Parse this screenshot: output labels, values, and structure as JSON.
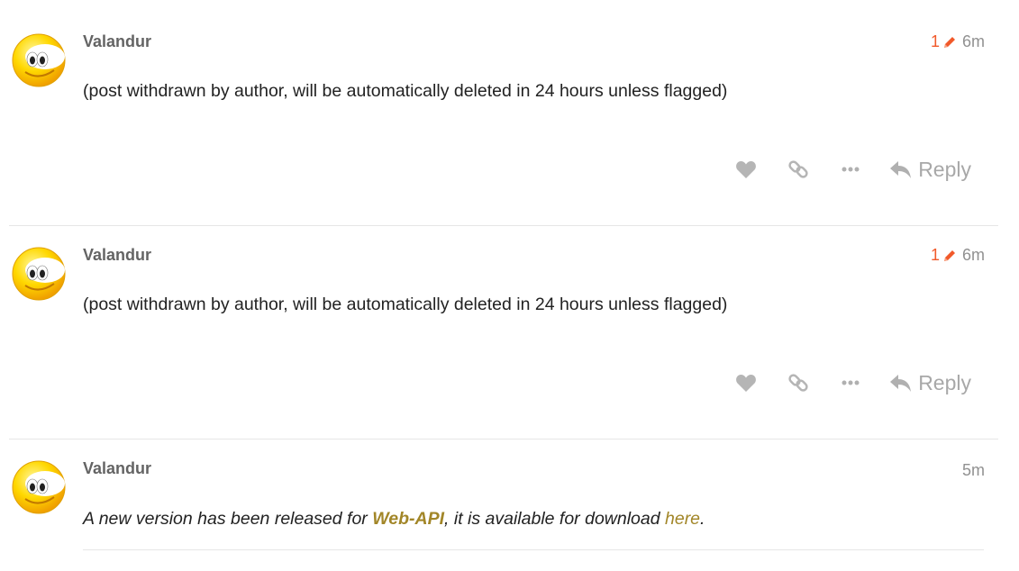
{
  "posts": [
    {
      "username": "Valandur",
      "edit_count": "1",
      "time": "6m",
      "body": "(post withdrawn by author, will be automatically deleted in 24 hours unless flagged)",
      "reply_label": "Reply"
    },
    {
      "username": "Valandur",
      "edit_count": "1",
      "time": "6m",
      "body": "(post withdrawn by author, will be automatically deleted in 24 hours unless flagged)",
      "reply_label": "Reply"
    },
    {
      "username": "Valandur",
      "time": "5m",
      "body_prefix": "A new version has been released for ",
      "body_link": "Web-API",
      "body_middle": ", it is available for download ",
      "body_link2": "here",
      "body_suffix": "."
    }
  ],
  "icons": {
    "avatar": "smiley-face-avatar",
    "edit": "pencil-icon",
    "like": "heart-icon",
    "share": "link-icon",
    "more": "ellipsis-icon",
    "reply": "reply-arrow-icon"
  },
  "colors": {
    "edit_accent": "#f1592a",
    "link": "#a28628",
    "icon_gray": "#b0b0b0"
  }
}
